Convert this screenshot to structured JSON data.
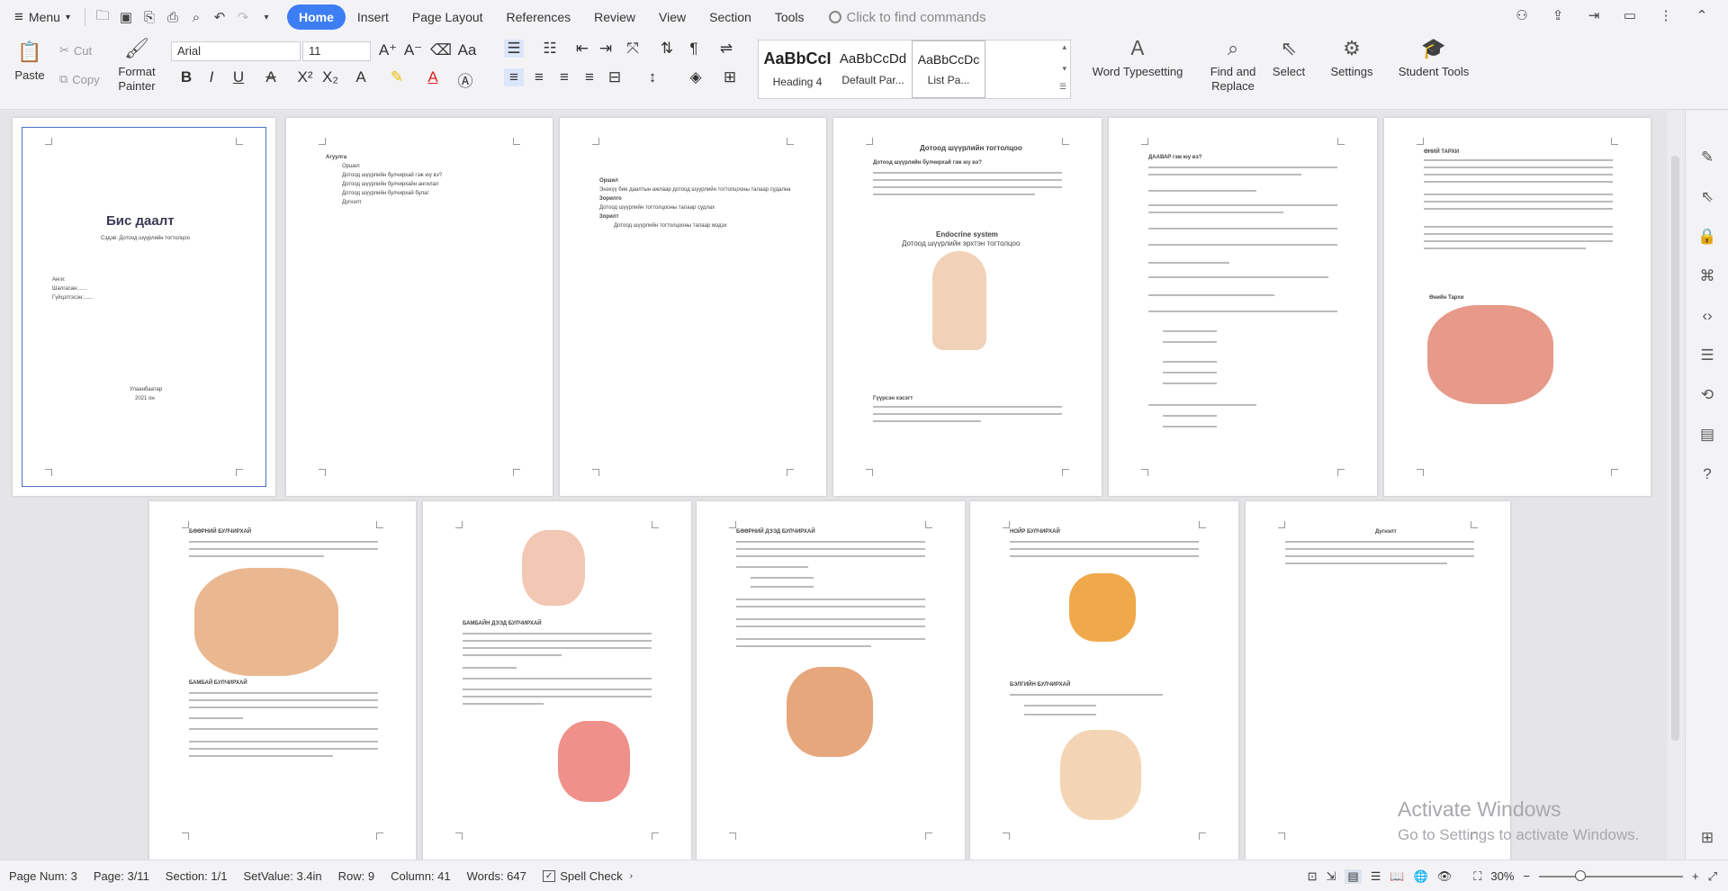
{
  "menu": {
    "menu_label": "Menu",
    "tabs": [
      "Home",
      "Insert",
      "Page Layout",
      "References",
      "Review",
      "View",
      "Section",
      "Tools"
    ],
    "search_placeholder": "Click to find commands"
  },
  "ribbon": {
    "paste": "Paste",
    "cut": "Cut",
    "copy": "Copy",
    "format_painter": "Format Painter",
    "font_name": "Arial",
    "font_size": "11",
    "styles": [
      {
        "sample": "AaBbCcI",
        "name": "Heading 4"
      },
      {
        "sample": "AaBbCcDd",
        "name": "Default Par..."
      },
      {
        "sample": "AaBbCcDc",
        "name": "List Pa..."
      }
    ],
    "word_typesetting": "Word Typesetting",
    "find_replace": "Find and Replace",
    "select": "Select",
    "settings": "Settings",
    "student_tools": "Student Tools"
  },
  "pages": {
    "p1": {
      "title": "Бис даалт",
      "subtitle": "Сэдэв: Дотоод шүүрлийн тогтолцоо",
      "lines": [
        "Анги:",
        "Шалгасан:......",
        "Гүйцэтгэсэн:......"
      ],
      "city": "Улаанбаатар",
      "year": "2021 он"
    },
    "p2": {
      "head": "Агуулга",
      "items": [
        "Оршил",
        "Дотоод шүүрлийн булчирхай гэж юу вэ?",
        "Дотоод шүүрлийн булчирхайн ангилал",
        "Дотоод шүүрлийн булчирхай булаг",
        "Дүгнэлт"
      ]
    },
    "p3": {
      "head": "Оршил",
      "line1": "Энэхүү бие даалтын ажлаар дотоод шүүрлийн тогтолцооны талаар судална",
      "line2": "Зорилго",
      "line3": "Дотоод шүүрлийн тогтолцооны талаар судлах",
      "line4": "Зорилт",
      "line5": "Дотоод шүүрлийн тогтолцооны талаар мэдэх"
    },
    "p4": {
      "title": "Дотоод шүүрлийн тогтолцоо",
      "q": "Дотоод шүүрлийн булчирхай гэж юу вэ?",
      "fig1": "Endocrine system",
      "fig2": "Дотоод шүүрлийн эрхтэн тогтолцоо",
      "tag": "Гүүрсэн хэсэгт"
    },
    "p5": {
      "head": "ДААВАР гэж юу вэ?"
    },
    "p6": {
      "head": "ӨНИЙ ТАРХИ",
      "caption": "Өнийн Тархи"
    },
    "p7": {
      "head": "БӨӨРНИЙ БУЛЧИРХАЙ",
      "sub": "БАМБАЙ БУЛЧИРХАЙ"
    },
    "p8": {
      "head": "БАМБАЙН ДЭЭД БУЛЧИРХАЙ"
    },
    "p9": {
      "head": "БӨӨРНИЙ ДЭЭД БУЛЧИРХАЙ"
    },
    "p10": {
      "head": "НОЙР БУЛЧИРХАЙ",
      "sub": "БЭЛГИЙН БУЛЧИРХАЙ"
    },
    "p11": {
      "head": "Дүгнэлт"
    }
  },
  "watermark": {
    "line1": "Activate Windows",
    "line2": "Go to Settings to activate Windows."
  },
  "status": {
    "page_num": "Page Num: 3",
    "page": "Page: 3/11",
    "section": "Section: 1/1",
    "setvalue": "SetValue: 3.4in",
    "row": "Row: 9",
    "column": "Column: 41",
    "words": "Words: 647",
    "spell": "Spell Check",
    "zoom": "30%"
  }
}
